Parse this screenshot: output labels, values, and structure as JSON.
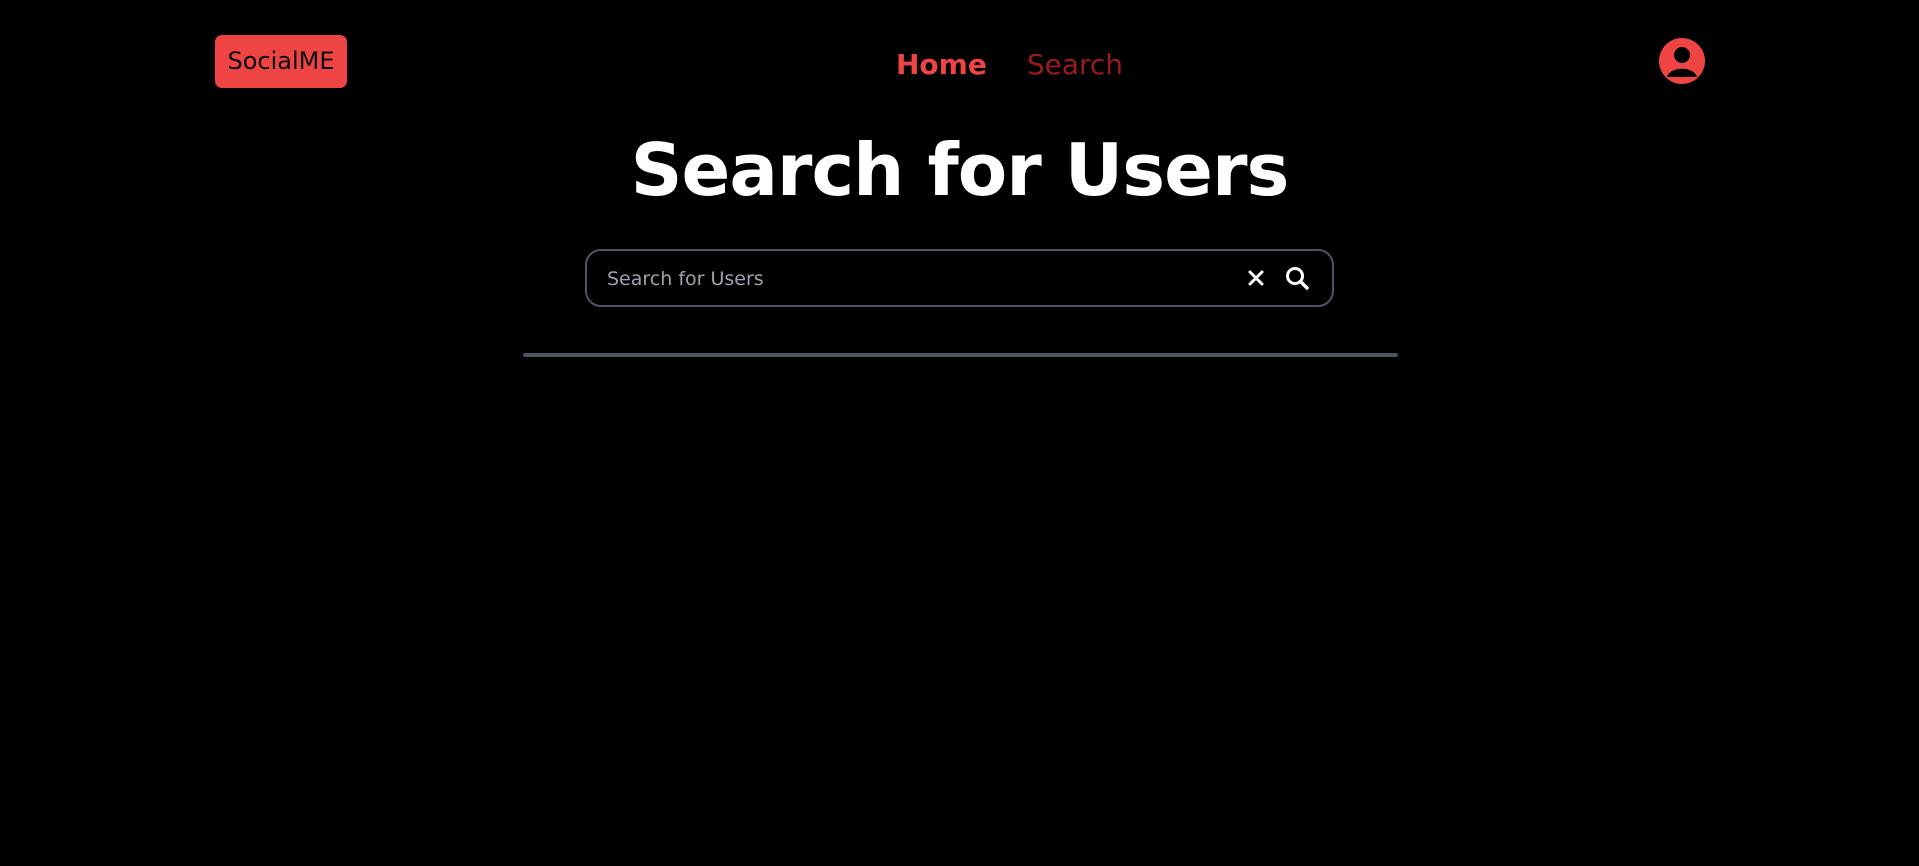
{
  "header": {
    "logo_text": "SocialME",
    "nav": [
      {
        "label": "Home",
        "active": true
      },
      {
        "label": "Search",
        "active": false
      }
    ],
    "avatar_icon": "user-circle-icon"
  },
  "main": {
    "title": "Search for Users",
    "search": {
      "placeholder": "Search for Users",
      "value": "",
      "clear_icon": "close-icon",
      "submit_icon": "search-icon"
    }
  },
  "colors": {
    "background": "#000000",
    "accent": "#ef4444",
    "accent_muted": "#991b1b",
    "title_text": "#ffffff",
    "border": "#4b5563",
    "placeholder": "#9ca3af"
  }
}
